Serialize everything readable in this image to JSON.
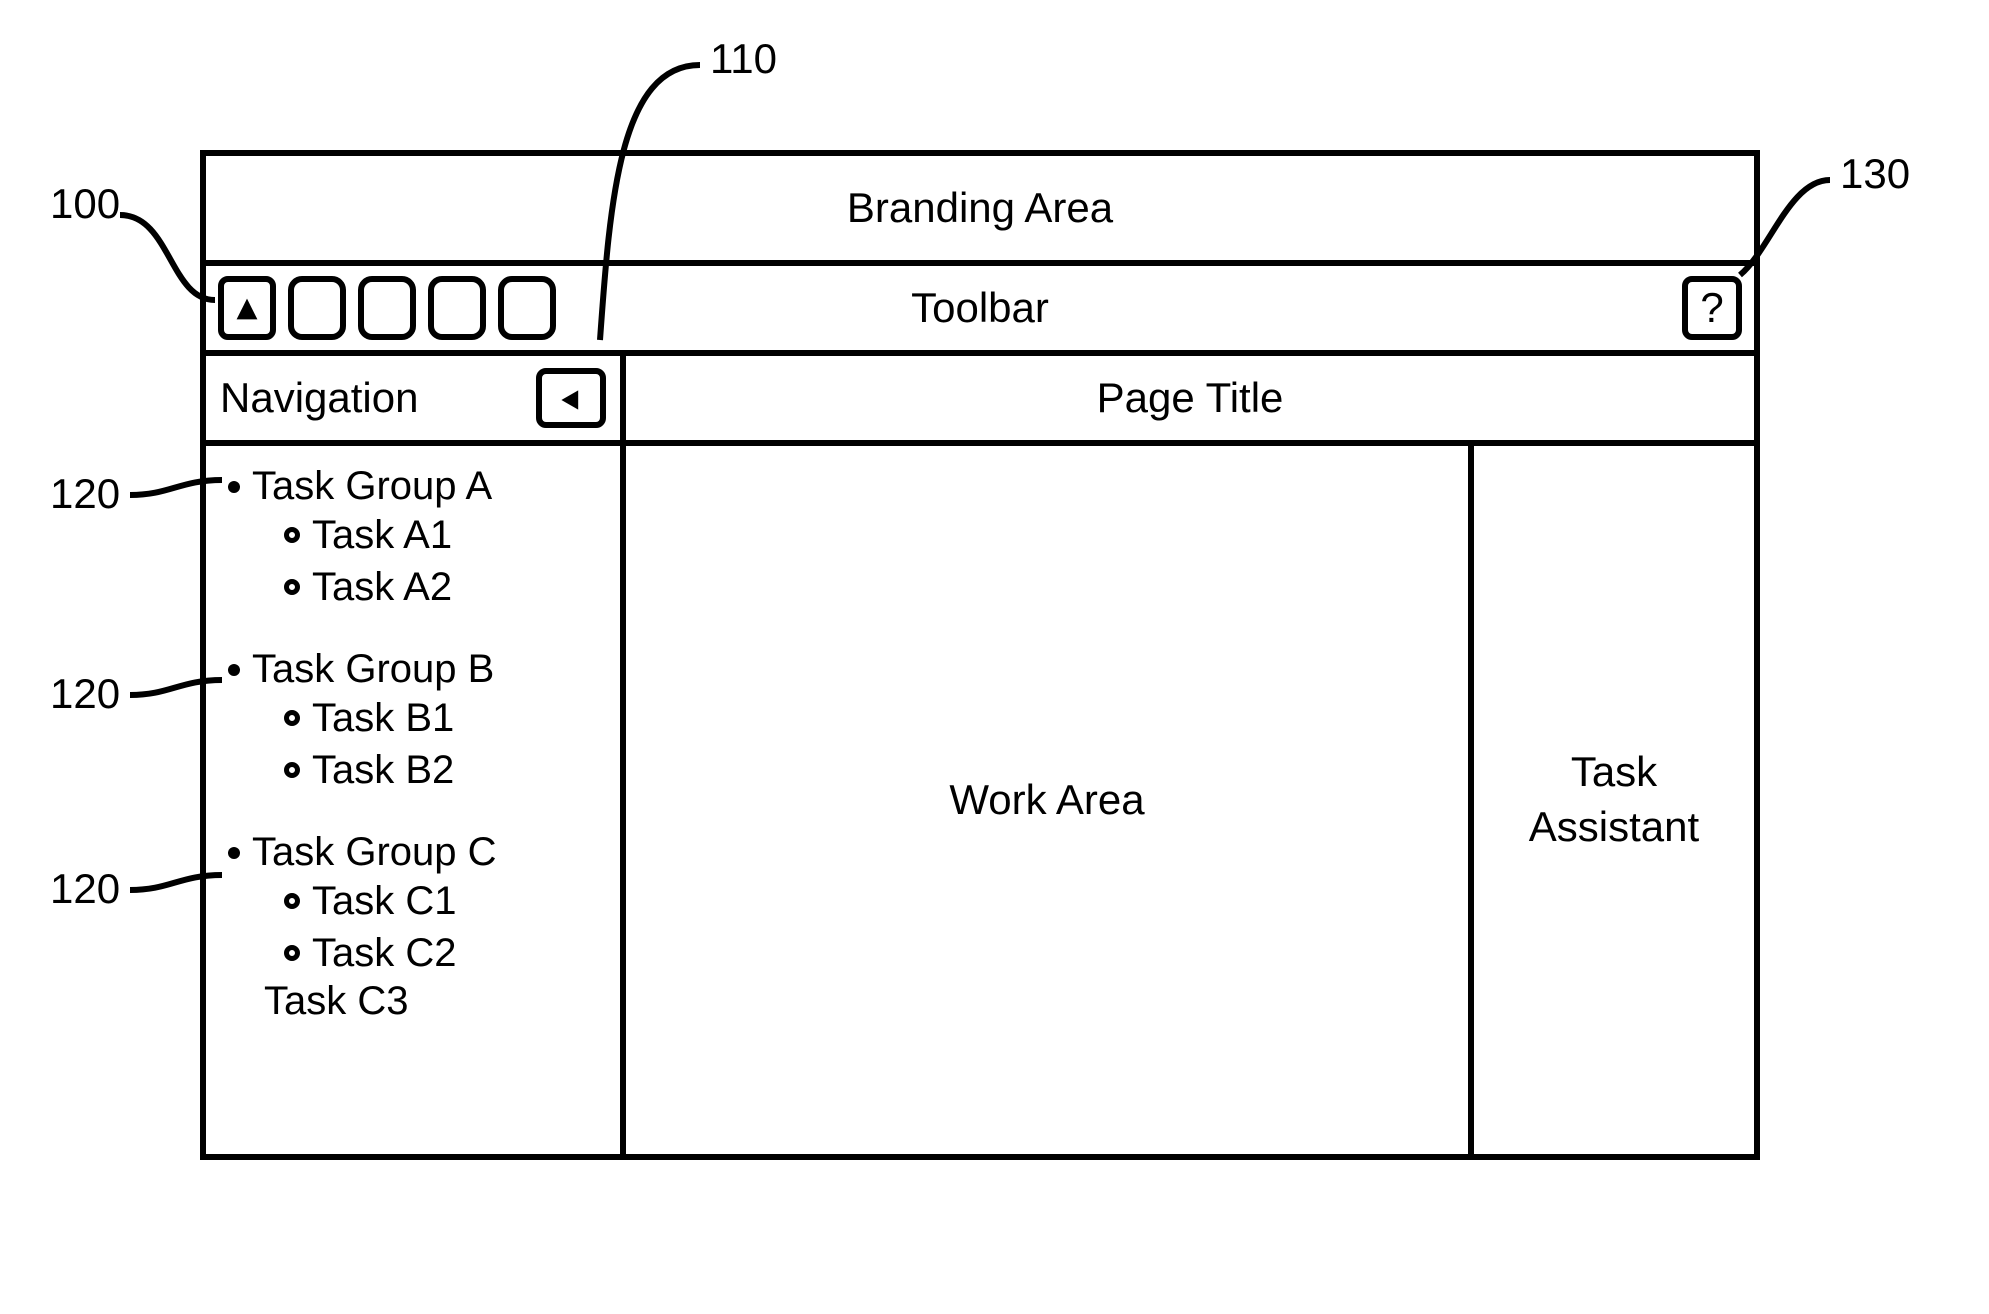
{
  "branding": {
    "label": "Branding Area"
  },
  "toolbar": {
    "label": "Toolbar",
    "help_label": "?",
    "button_icons": [
      "up-triangle-icon",
      "blank-icon",
      "blank-icon",
      "blank-icon",
      "blank-icon"
    ]
  },
  "navigation": {
    "header_label": "Navigation",
    "collapse_icon": "left-triangle-icon",
    "groups": [
      {
        "label": "Task Group A",
        "tasks": [
          "Task A1",
          "Task A2"
        ]
      },
      {
        "label": "Task Group B",
        "tasks": [
          "Task B1",
          "Task B2"
        ]
      },
      {
        "label": "Task Group C",
        "tasks": [
          "Task C1",
          "Task C2"
        ]
      }
    ],
    "extra_task": "Task C3"
  },
  "page": {
    "title": "Page Title"
  },
  "work_area": {
    "label": "Work Area"
  },
  "assistant": {
    "label": "Task\nAssistant"
  },
  "callouts": {
    "c100": "100",
    "c110": "110",
    "c120": "120",
    "c130": "130"
  }
}
